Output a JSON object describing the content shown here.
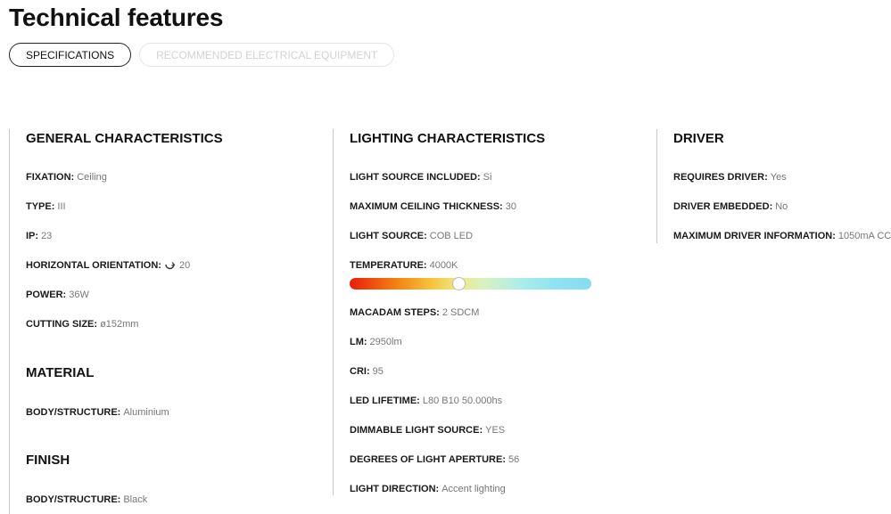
{
  "title": "Technical features",
  "tabs": [
    {
      "label": "SPECIFICATIONS"
    },
    {
      "label": "RECOMMENDED ELECTRICAL EQUIPMENT"
    }
  ],
  "general": {
    "title": "GENERAL CHARACTERISTICS",
    "rows": [
      {
        "label": "FIXATION:",
        "value": "Ceiling"
      },
      {
        "label": "TYPE:",
        "value": "III"
      },
      {
        "label": "IP:",
        "value": "23"
      },
      {
        "label": "HORIZONTAL ORIENTATION:",
        "value": "20",
        "icon": "rotate-icon"
      },
      {
        "label": "POWER:",
        "value": "36W"
      },
      {
        "label": "CUTTING SIZE:",
        "value": "ø152mm"
      }
    ]
  },
  "material": {
    "title": "MATERIAL",
    "rows": [
      {
        "label": "BODY/STRUCTURE:",
        "value": "Aluminium"
      }
    ]
  },
  "finish": {
    "title": "FINISH",
    "rows": [
      {
        "label": "BODY/STRUCTURE:",
        "value": "Black"
      }
    ]
  },
  "lighting": {
    "title": "LIGHTING CHARACTERISTICS",
    "rows": [
      {
        "label": "LIGHT SOURCE INCLUDED:",
        "value": "Si"
      },
      {
        "label": "MAXIMUM CEILING THICKNESS:",
        "value": "30"
      },
      {
        "label": "LIGHT SOURCE:",
        "value": "COB LED"
      },
      {
        "label": "TEMPERATURE:",
        "value": "4000K"
      },
      {
        "label": "MACADAM STEPS:",
        "value": "2 SDCM"
      },
      {
        "label": "LM:",
        "value": "2950lm"
      },
      {
        "label": "CRI:",
        "value": "95"
      },
      {
        "label": "LED LIFETIME:",
        "value": "L80 B10 50.000hs"
      },
      {
        "label": "DIMMABLE LIGHT SOURCE:",
        "value": "YES"
      },
      {
        "label": "DEGREES OF LIGHT APERTURE:",
        "value": "56"
      },
      {
        "label": "LIGHT DIRECTION:",
        "value": "Accent lighting"
      }
    ],
    "temperature_scale_position": 0.45
  },
  "driver": {
    "title": "DRIVER",
    "rows": [
      {
        "label": "REQUIRES DRIVER:",
        "value": "Yes"
      },
      {
        "label": "DRIVER EMBEDDED:",
        "value": "No"
      },
      {
        "label": "MAXIMUM DRIVER INFORMATION:",
        "value": "1050mA CC"
      }
    ]
  }
}
